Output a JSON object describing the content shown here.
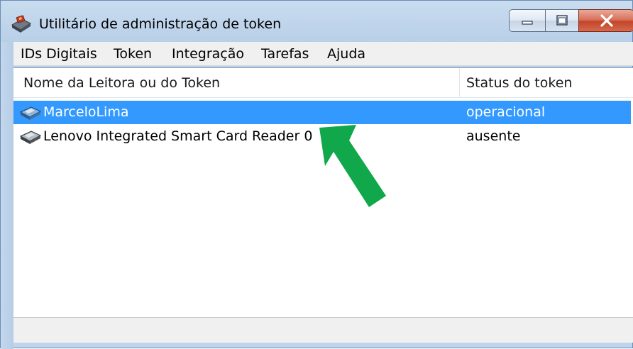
{
  "window": {
    "title": "Utilitário de administração de token",
    "app_icon": "smartcard-reader-icon"
  },
  "menu": [
    {
      "label": "IDs Digitais"
    },
    {
      "label": "Token"
    },
    {
      "label": "Integração"
    },
    {
      "label": "Tarefas"
    },
    {
      "label": "Ajuda"
    }
  ],
  "list": {
    "columns": [
      "Nome da Leitora ou do Token",
      "Status do token"
    ],
    "rows": [
      {
        "name": "MarceloLima",
        "status": "operacional",
        "selected": true,
        "icon": "token-icon"
      },
      {
        "name": "Lenovo Integrated Smart Card Reader 0",
        "status": "ausente",
        "selected": false,
        "icon": "card-reader-icon"
      }
    ]
  },
  "colors": {
    "selection": "#3399ff",
    "annotation_arrow": "#10a84a",
    "close_button": "#c4452a"
  },
  "annotation": {
    "icon": "arrow-icon"
  }
}
